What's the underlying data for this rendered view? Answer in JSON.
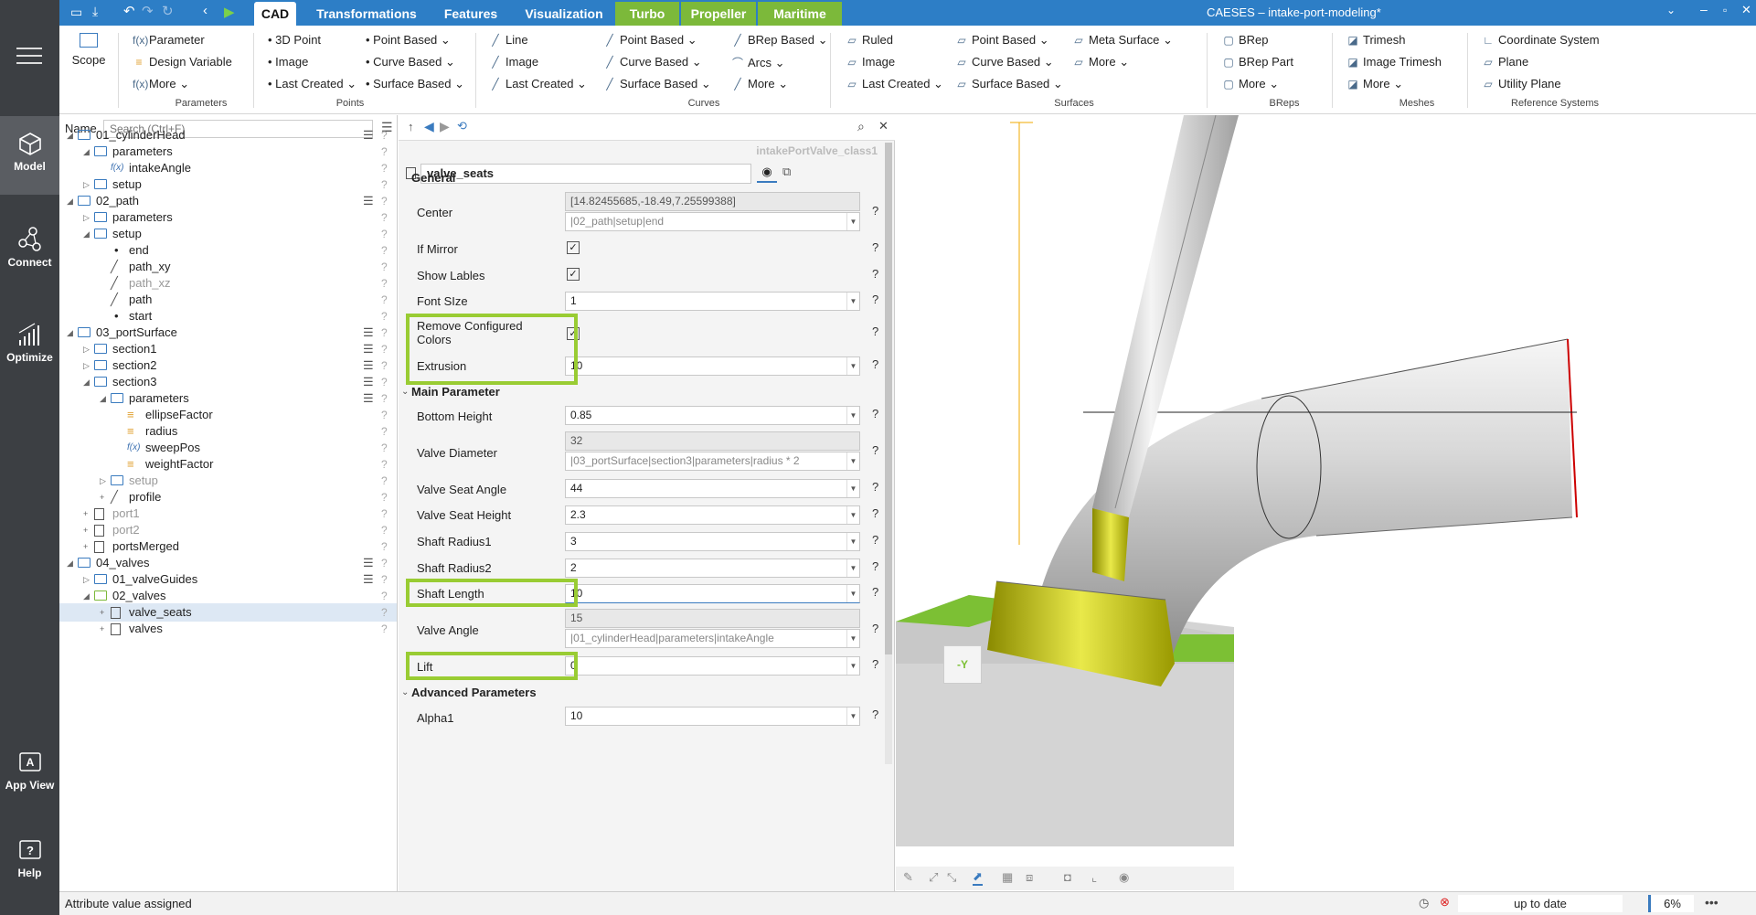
{
  "leftbar": {
    "items": [
      {
        "label": "Model"
      },
      {
        "label": "Connect"
      },
      {
        "label": "Optimize"
      },
      {
        "label": "App View"
      },
      {
        "label": "Help"
      }
    ]
  },
  "titlebar": {
    "title": "CAESES – intake-port-modeling*",
    "tabs": [
      "CAD",
      "Transformations",
      "Features",
      "Visualization",
      "Turbo",
      "Propeller",
      "Maritime"
    ]
  },
  "ribbon": {
    "scope": "Scope",
    "parameters": {
      "items": [
        "Parameter",
        "Design Variable",
        "More"
      ],
      "label": "Parameters"
    },
    "points": {
      "col1": [
        "3D Point",
        "Image",
        "Last Created"
      ],
      "col2": [
        "Point Based",
        "Curve Based",
        "Surface Based"
      ],
      "label": "Points"
    },
    "curves": {
      "col1": [
        "Line",
        "Image",
        "Last Created"
      ],
      "col2": [
        "Point Based",
        "Curve Based",
        "Surface Based"
      ],
      "col3": [
        "BRep Based",
        "Arcs",
        "More"
      ],
      "label": "Curves"
    },
    "surfaces": {
      "col1": [
        "Ruled",
        "Image",
        "Last Created"
      ],
      "col2": [
        "Point Based",
        "Curve Based",
        "Surface Based"
      ],
      "col3": [
        "Meta Surface",
        "More"
      ],
      "label": "Surfaces"
    },
    "breps": {
      "items": [
        "BRep",
        "BRep Part",
        "More"
      ],
      "label": "BReps"
    },
    "meshes": {
      "items": [
        "Trimesh",
        "Image Trimesh",
        "More"
      ],
      "label": "Meshes"
    },
    "refsys": {
      "items": [
        "Coordinate System",
        "Plane",
        "Utility Plane"
      ],
      "label": "Reference Systems"
    }
  },
  "tree": {
    "header": "Name",
    "search_placeholder": "Search (Ctrl+F)",
    "rows": [
      "01_cylinderHead",
      "parameters",
      "intakeAngle",
      "setup",
      "02_path",
      "parameters",
      "setup",
      "end",
      "path_xy",
      "path_xz",
      "path",
      "start",
      "03_portSurface",
      "section1",
      "section2",
      "section3",
      "parameters",
      "ellipseFactor",
      "radius",
      "sweepPos",
      "weightFactor",
      "setup",
      "profile",
      "port1",
      "port2",
      "portsMerged",
      "04_valves",
      "01_valveGuides",
      "02_valves",
      "valve_seats",
      "valves"
    ]
  },
  "props": {
    "class_name": "intakePortValve_class1",
    "object_name": "valve_seats",
    "sections": {
      "general": "General",
      "main": "Main Parameter",
      "advanced": "Advanced Parameters"
    },
    "center": {
      "label": "Center",
      "value": "[14.82455685,-18.49,7.25599388]",
      "ref": "|02_path|setup|end"
    },
    "if_mirror": "If Mirror",
    "show_labels": "Show Lables",
    "font_size": {
      "label": "Font SIze",
      "value": "1"
    },
    "remove_colors": "Remove Configured Colors",
    "extrusion": {
      "label": "Extrusion",
      "value": "10"
    },
    "bottom_height": {
      "label": "Bottom Height",
      "value": "0.85"
    },
    "valve_diameter": {
      "label": "Valve Diameter",
      "value": "32",
      "ref": "|03_portSurface|section3|parameters|radius * 2"
    },
    "valve_seat_angle": {
      "label": "Valve Seat Angle",
      "value": "44"
    },
    "valve_seat_height": {
      "label": "Valve Seat Height",
      "value": "2.3"
    },
    "shaft_radius1": {
      "label": "Shaft Radius1",
      "value": "3"
    },
    "shaft_radius2": {
      "label": "Shaft Radius2",
      "value": "2"
    },
    "shaft_length": {
      "label": "Shaft Length",
      "value": "10"
    },
    "valve_angle": {
      "label": "Valve Angle",
      "value": "15",
      "ref": "|01_cylinderHead|parameters|intakeAngle"
    },
    "lift": {
      "label": "Lift",
      "value": "0"
    },
    "alpha1": {
      "label": "Alpha1",
      "value": "10"
    }
  },
  "viewport": {
    "axis_label": "-Y"
  },
  "status": {
    "message": "Attribute value assigned",
    "state": "up to date",
    "percent": "6%"
  }
}
